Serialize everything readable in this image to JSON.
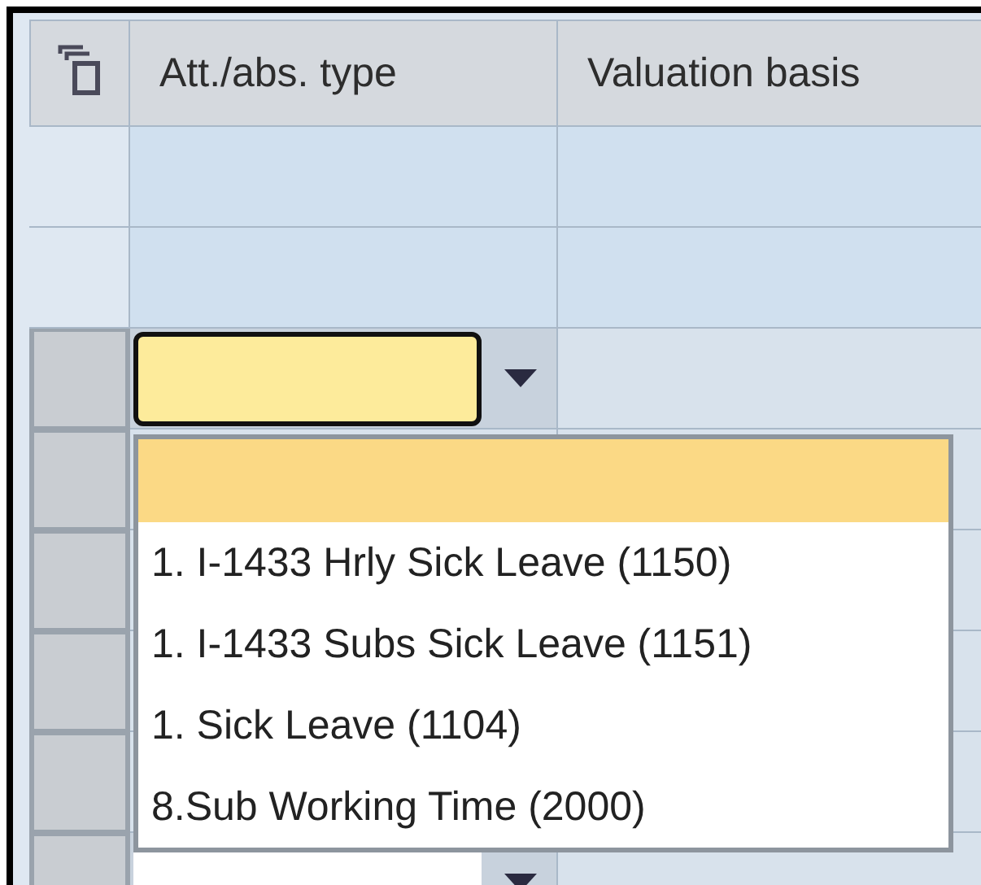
{
  "table": {
    "columns": [
      "Att./abs. type",
      "Valuation basis"
    ],
    "rows": [
      {
        "kind": "plain"
      },
      {
        "kind": "plain"
      },
      {
        "kind": "combo",
        "focused": true
      },
      {
        "kind": "gray"
      },
      {
        "kind": "gray"
      },
      {
        "kind": "gray"
      },
      {
        "kind": "gray"
      },
      {
        "kind": "combo",
        "focused": false
      }
    ]
  },
  "dropdown": {
    "blank_option_highlighted": true,
    "options": [
      {
        "label": "1. I-1433 Hrly Sick Leave (1150)",
        "selected": false
      },
      {
        "label": "1. I-1433 Subs Sick Leave (1151)",
        "selected": false
      },
      {
        "label": "1. Sick Leave (1104)",
        "selected": false
      },
      {
        "label": "8.Sub Working Time (2000)",
        "selected": false
      }
    ]
  }
}
